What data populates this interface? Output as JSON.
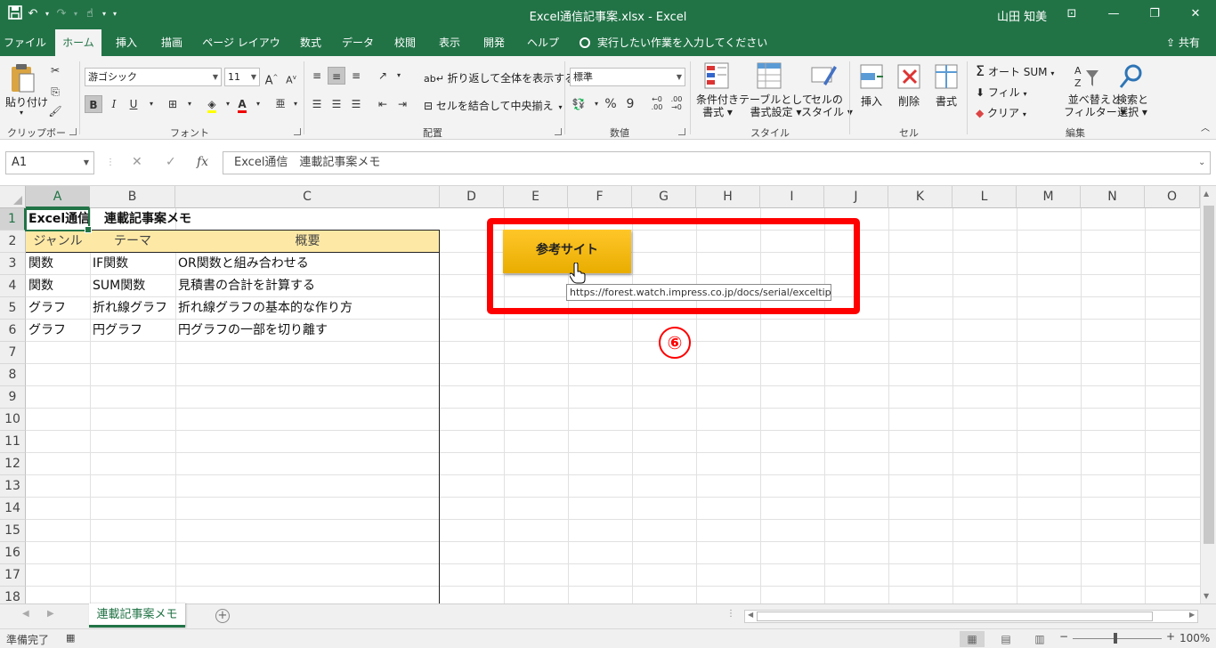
{
  "window": {
    "title": "Excel通信記事案.xlsx  -  Excel",
    "user": "山田 知美",
    "qat": {
      "save_icon": "floppy-icon",
      "undo": "↶",
      "redo": "↷",
      "touch": "☝",
      "customize": "▾"
    },
    "controls": {
      "ribbon_opts": "⊡",
      "minimize": "—",
      "restore": "❐",
      "close": "✕"
    }
  },
  "ribbon_tabs": [
    "ファイル",
    "ホーム",
    "挿入",
    "描画",
    "ページ レイアウト",
    "数式",
    "データ",
    "校閲",
    "表示",
    "開発",
    "ヘルプ"
  ],
  "active_tab": "ホーム",
  "tell_me": "実行したい作業を入力してください",
  "share": "共有",
  "ribbon": {
    "clipboard": {
      "paste": "貼り付け",
      "label": "クリップボード"
    },
    "font": {
      "name": "游ゴシック",
      "size": "11",
      "bold": "B",
      "italic": "I",
      "underline": "U",
      "label": "フォント"
    },
    "alignment": {
      "wrap": "折り返して全体を表示する",
      "merge": "セルを結合して中央揃え",
      "label": "配置"
    },
    "number": {
      "format": "標準",
      "percent": "%",
      "comma": "9",
      "label": "数値"
    },
    "styles": {
      "conditional": "条件付き\n書式",
      "table": "テーブルとして\n書式設定",
      "cell": "セルの\nスタイル",
      "label": "スタイル",
      "conditional_1": "条件付き",
      "conditional_2": "書式",
      "table_1": "テーブルとして",
      "table_2": "書式設定",
      "cell_1": "セルの",
      "cell_2": "スタイル"
    },
    "cells": {
      "insert": "挿入",
      "delete": "削除",
      "format": "書式",
      "label": "セル"
    },
    "editing": {
      "autosum": "オート SUM",
      "fill": "フィル",
      "clear": "クリア",
      "sort_1": "並べ替えと",
      "sort_2": "フィルター",
      "find_1": "検索と",
      "find_2": "選択",
      "label": "編集"
    }
  },
  "formula_bar": {
    "name_box": "A1",
    "cancel": "✕",
    "enter": "✓",
    "fx": "fx",
    "content": "Excel通信　連載記事案メモ"
  },
  "columns": [
    "A",
    "B",
    "C",
    "D",
    "E",
    "F",
    "G",
    "H",
    "I",
    "J",
    "K",
    "L",
    "M",
    "N",
    "O"
  ],
  "rows": [
    "1",
    "2",
    "3",
    "4",
    "5",
    "6",
    "7",
    "8",
    "9",
    "10",
    "11",
    "12",
    "13",
    "14",
    "15",
    "16",
    "17",
    "18"
  ],
  "sheet": {
    "title_a1": "Excel通信",
    "title_b1": "連載記事案メモ",
    "headers": [
      "ジャンル",
      "テーマ",
      "概要"
    ],
    "rows": [
      [
        "関数",
        "IF関数",
        "OR関数と組み合わせる"
      ],
      [
        "関数",
        "SUM関数",
        "見積書の合計を計算する"
      ],
      [
        "グラフ",
        "折れ線グラフ",
        "折れ線グラフの基本的な作り方"
      ],
      [
        "グラフ",
        "円グラフ",
        "円グラフの一部を切り離す"
      ]
    ],
    "header_fill": "#fde9a5"
  },
  "shape_button": {
    "label": "参考サイト",
    "color": "#ffc000"
  },
  "hyperlink_tooltip": "https://forest.watch.impress.co.jp/docs/serial/exceltips/",
  "annotation": {
    "marker": "⑥",
    "color": "#ff0000"
  },
  "sheet_tab": {
    "name": "連載記事案メモ",
    "add": "+"
  },
  "status": {
    "text": "準備完了",
    "zoom": "100%",
    "zoom_minus": "−",
    "zoom_plus": "+"
  }
}
